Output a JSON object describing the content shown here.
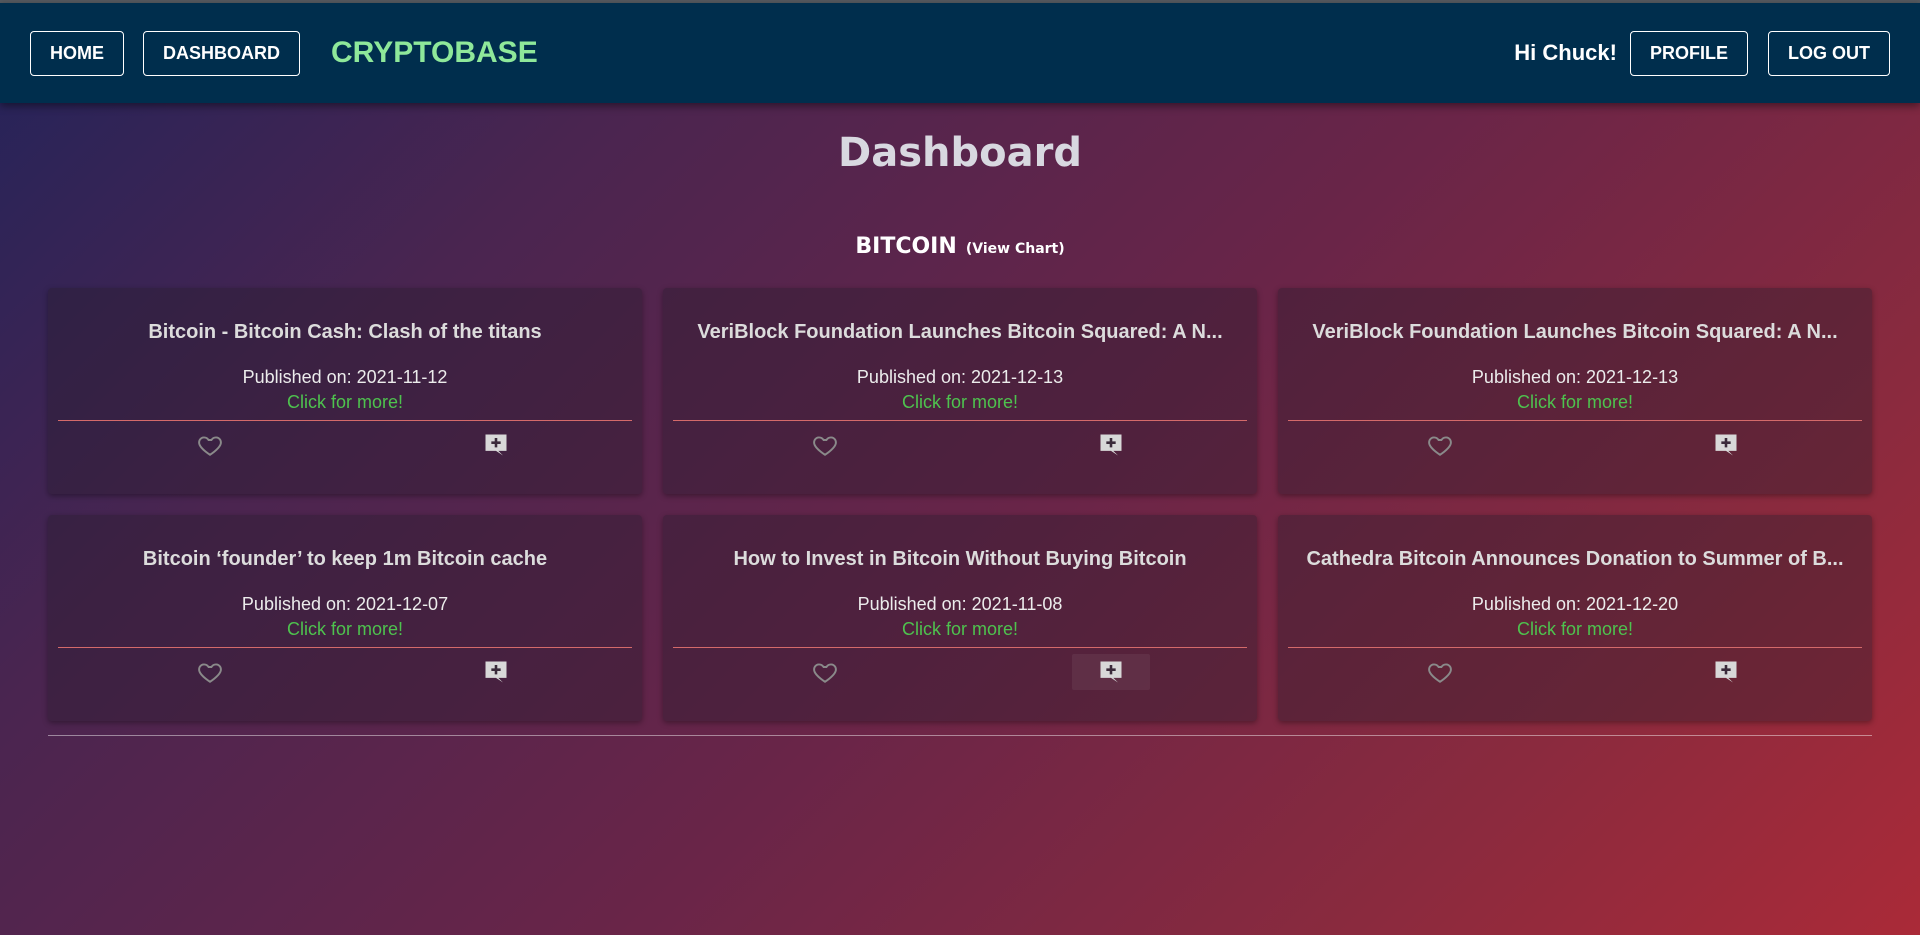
{
  "nav": {
    "home_label": "HOME",
    "dashboard_label": "DASHBOARD",
    "brand": "CRYPTOBASE",
    "greeting": "Hi Chuck!",
    "profile_label": "PROFILE",
    "logout_label": "LOG OUT"
  },
  "page": {
    "title": "Dashboard"
  },
  "section": {
    "coin": "BITCOIN",
    "view_chart": "(View Chart)"
  },
  "cards": [
    {
      "title": "Bitcoin - Bitcoin Cash: Clash of the titans",
      "date": "Published on: 2021-11-12",
      "more": "Click for more!"
    },
    {
      "title": "VeriBlock Foundation Launches Bitcoin Squared: A N...",
      "date": "Published on: 2021-12-13",
      "more": "Click for more!"
    },
    {
      "title": "VeriBlock Foundation Launches Bitcoin Squared: A N...",
      "date": "Published on: 2021-12-13",
      "more": "Click for more!"
    },
    {
      "title": "Bitcoin ‘founder’ to keep 1m Bitcoin cache",
      "date": "Published on: 2021-12-07",
      "more": "Click for more!"
    },
    {
      "title": "How to Invest in Bitcoin Without Buying Bitcoin",
      "date": "Published on: 2021-11-08",
      "more": "Click for more!"
    },
    {
      "title": "Cathedra Bitcoin Announces Donation to Summer of B...",
      "date": "Published on: 2021-12-20",
      "more": "Click for more!"
    }
  ],
  "icons": {
    "like": "heart-outline-icon",
    "comment": "add-comment-icon"
  },
  "colors": {
    "navbar": "#002e4d",
    "brand": "#8ee89a",
    "link_green": "#4ec24e",
    "card_rule": "#d46a6a"
  }
}
